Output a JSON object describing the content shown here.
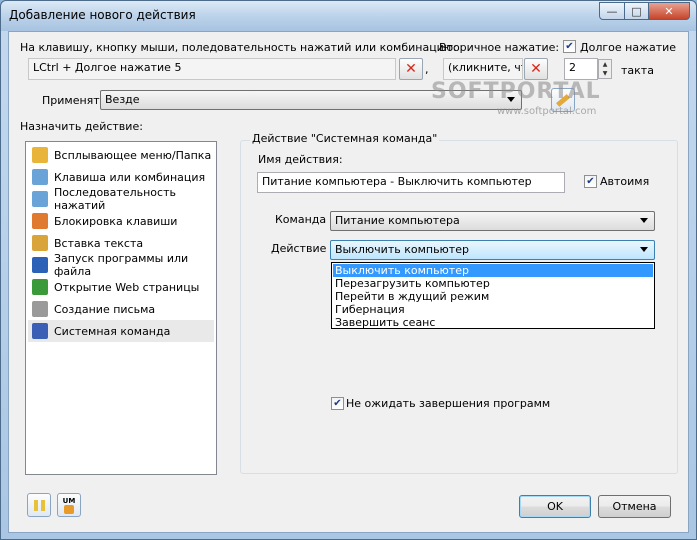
{
  "window": {
    "title": "Добавление нового действия",
    "controls": {
      "minimize": "—",
      "maximize": "□",
      "close": "✕"
    }
  },
  "hotkey": {
    "label": "На клавишу, кнопку мыши, поледовательность нажатий или комбинацию:",
    "value": "LCtrl + Долгое нажатие 5",
    "separator": ",",
    "secondary_label": "Вторичное нажатие:",
    "secondary_value": "(кликните, что",
    "long_press_label": "Долгое нажатие",
    "long_press_checked": true,
    "ticks_value": "2",
    "ticks_label": "такта"
  },
  "apply": {
    "label": "Применять",
    "value": "Везде"
  },
  "watermark": {
    "logo": "SOFTPORTAL",
    "url": "www.softportal.com"
  },
  "assign": {
    "label": "Назначить действие:",
    "items": [
      {
        "label": "Всплывающее меню/Папка",
        "icon": "folder-menu-icon",
        "color": "#e8b53a"
      },
      {
        "label": "Клавиша или комбинация",
        "icon": "key-icon",
        "color": "#6aa3d8"
      },
      {
        "label": "Последовательность нажатий",
        "icon": "keys-sequence-icon",
        "color": "#6aa3d8"
      },
      {
        "label": "Блокировка клавиши",
        "icon": "lock-key-icon",
        "color": "#e07a2e"
      },
      {
        "label": "Вставка текста",
        "icon": "paste-text-icon",
        "color": "#d9a43a"
      },
      {
        "label": "Запуск программы или файла",
        "icon": "run-program-icon",
        "color": "#2b62b8"
      },
      {
        "label": "Открытие Web страницы",
        "icon": "web-page-icon",
        "color": "#3a9a3a"
      },
      {
        "label": "Создание письма",
        "icon": "mail-icon",
        "color": "#9a9a9a"
      },
      {
        "label": "Системная команда",
        "icon": "system-command-icon",
        "color": "#3b5fb5"
      }
    ],
    "selected_index": 8
  },
  "action_group": {
    "title": "Действие \"Системная команда\"",
    "name_label": "Имя действия:",
    "name_value": "Питание компьютера - Выключить компьютер",
    "autoname_label": "Автоимя",
    "autoname_checked": true,
    "command_label": "Команда",
    "command_value": "Питание компьютера",
    "action_label": "Действие",
    "action_value": "Выключить компьютер",
    "action_options": [
      "Выключить компьютер",
      "Перезагрузить компьютер",
      "Перейти в ждущий режим",
      "Гибернация",
      "Завершить сеанс"
    ],
    "action_selected_index": 0,
    "nowait_label": "Не ожидать завершения программ",
    "nowait_checked": true
  },
  "footer": {
    "ok_label": "OK",
    "cancel_label": "Отмена",
    "um_badge": "UM"
  },
  "colors": {
    "accent": "#3399ff",
    "clear_x": "#d9281b",
    "selection_gray": "#e9e9e9"
  }
}
